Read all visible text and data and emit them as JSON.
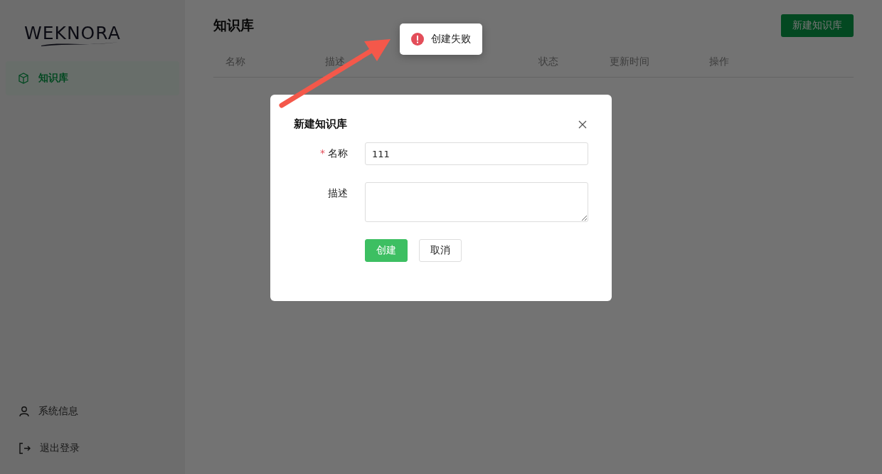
{
  "logo": {
    "text": "WEKNORA"
  },
  "sidebar": {
    "items": [
      {
        "label": "知识库",
        "selected": true
      }
    ],
    "footer_items": [
      {
        "label": "系统信息",
        "kind": "user"
      },
      {
        "label": "退出登录",
        "kind": "logout"
      }
    ]
  },
  "page": {
    "title": "知识库",
    "new_button": "新建知识库"
  },
  "table": {
    "columns": [
      "名称",
      "描述",
      "状态",
      "更新时间",
      "操作"
    ]
  },
  "dialog": {
    "title": "新建知识库",
    "fields": [
      {
        "label": "名称",
        "required_mark": "*",
        "kind": "input",
        "value": "111"
      },
      {
        "label": "描述",
        "kind": "textarea"
      }
    ],
    "buttons": [
      {
        "label": "创建",
        "kind": "primary"
      },
      {
        "label": "取消",
        "kind": "default"
      }
    ]
  },
  "toast": {
    "message": "创建失败",
    "kind": "error"
  }
}
